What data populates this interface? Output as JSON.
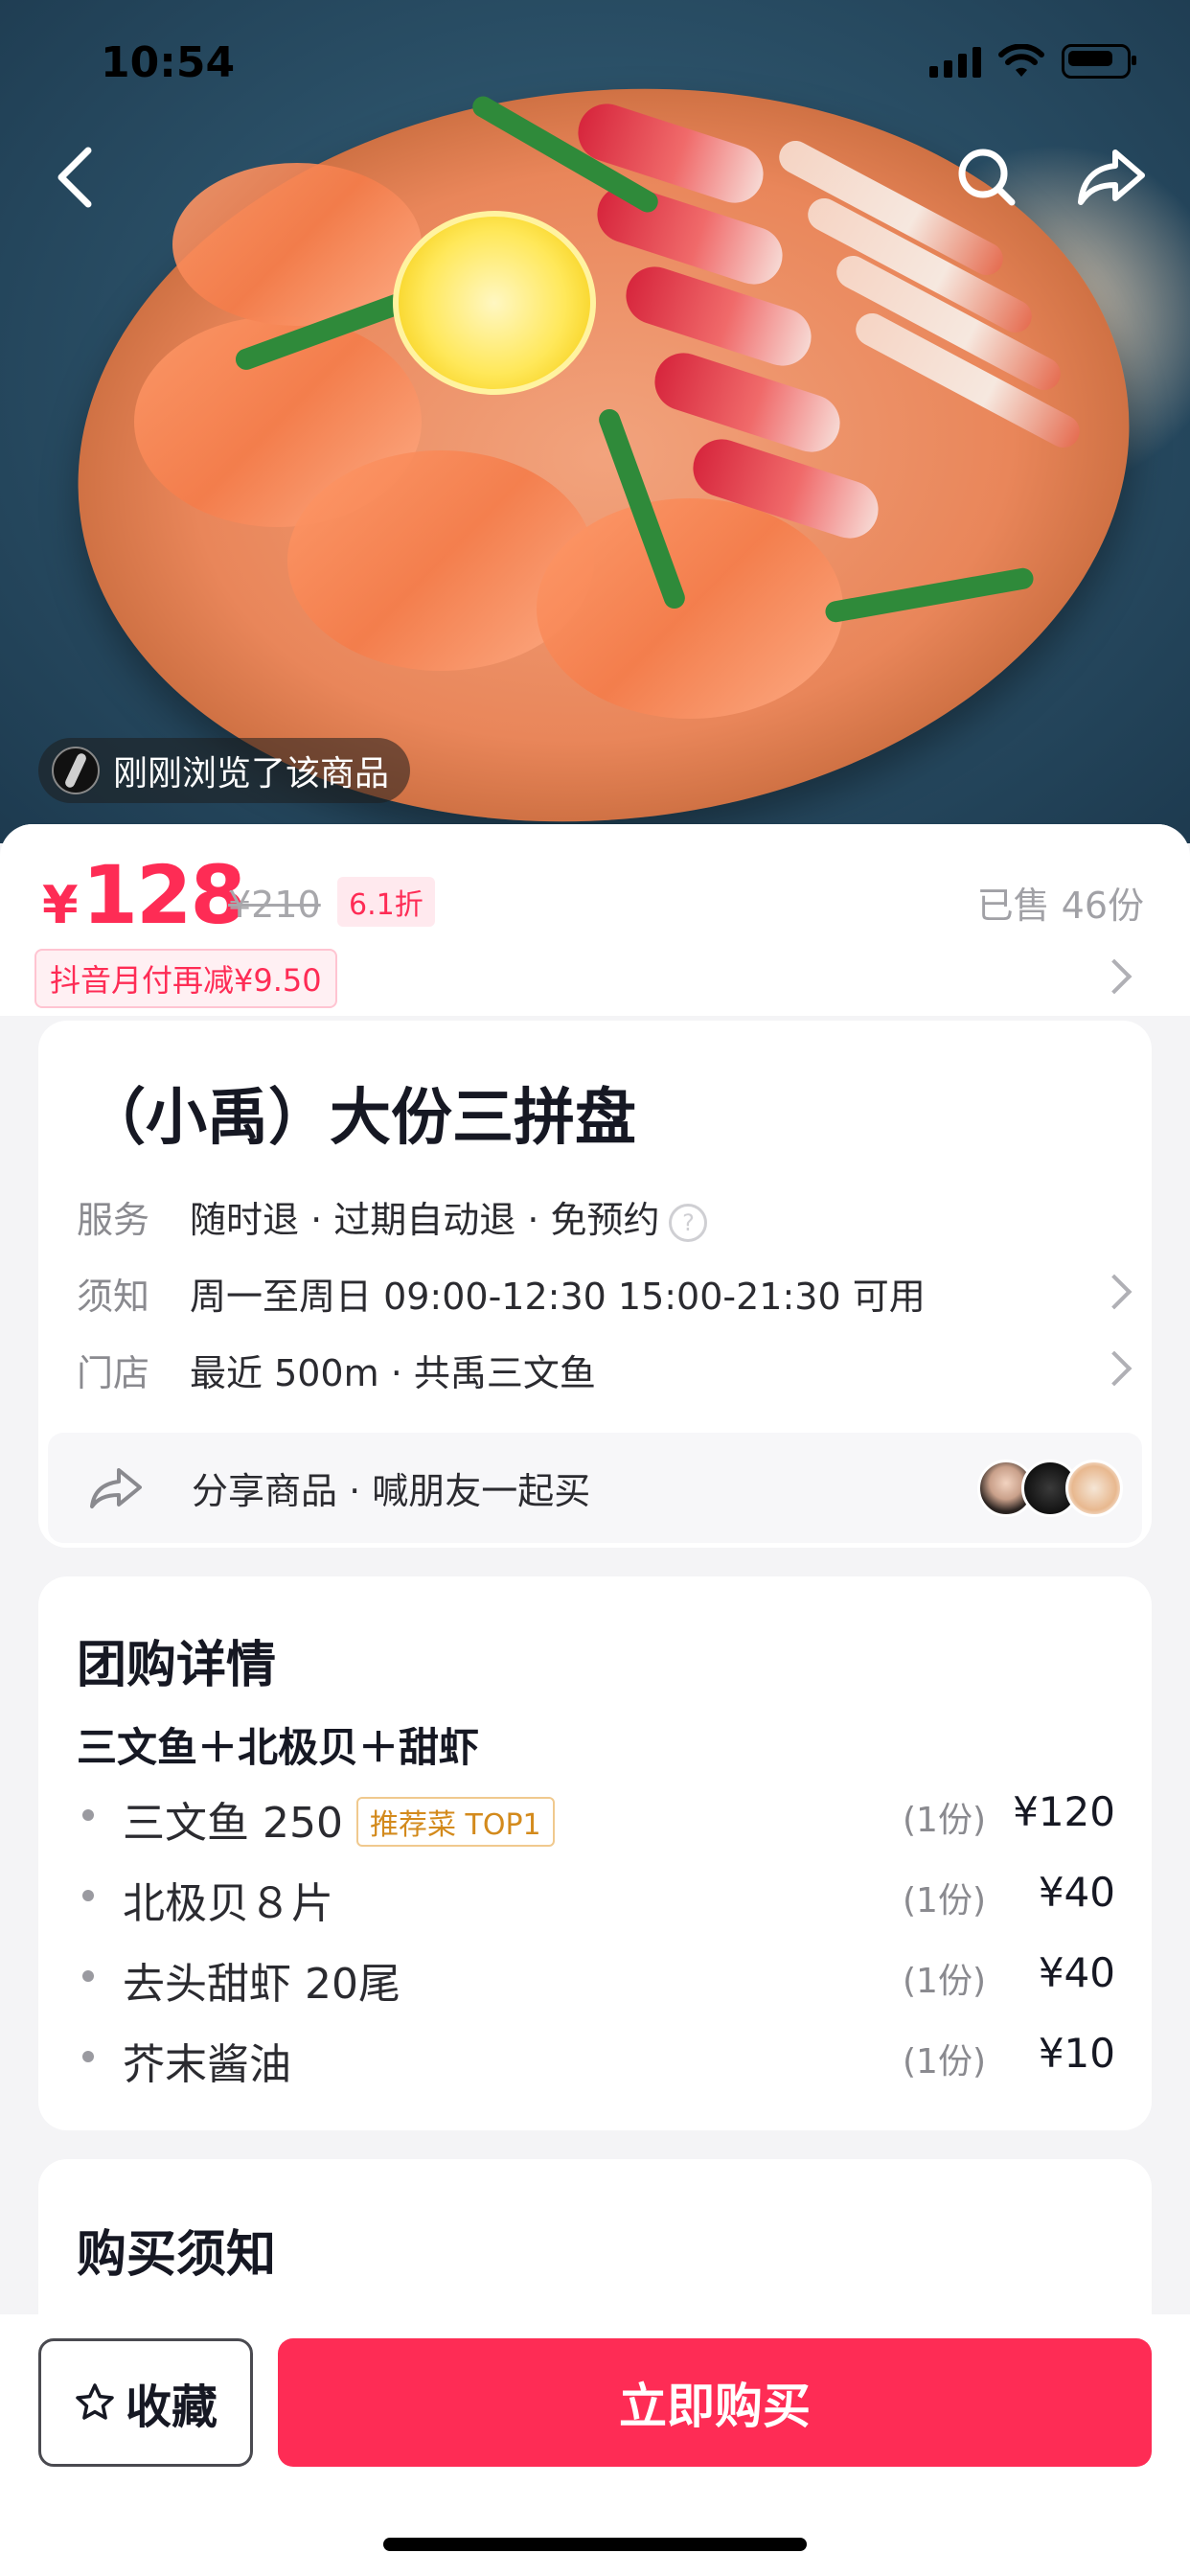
{
  "status_bar": {
    "time": "10:54"
  },
  "hero": {
    "viewed_text": "刚刚浏览了该商品"
  },
  "price": {
    "symbol": "¥",
    "current": "128",
    "original": "¥210",
    "discount": "6.1折",
    "sold": "已售 46份",
    "promo": "抖音月付再减¥9.50"
  },
  "product": {
    "title": "（小禹）大份三拼盘",
    "rows": [
      {
        "label": "服务",
        "value": "随时退 · 过期自动退 · 免预约",
        "help": "?"
      },
      {
        "label": "须知",
        "value": "周一至周日 09:00-12:30 15:00-21:30 可用"
      },
      {
        "label": "门店",
        "value": "最近 500m · 共禹三文鱼"
      }
    ],
    "share": "分享商品 · 喊朋友一起买"
  },
  "group_detail": {
    "title": "团购详情",
    "subtitle": "三文鱼＋北极贝＋甜虾",
    "items": [
      {
        "name": "三文鱼 250",
        "tag": "推荐菜 TOP1",
        "qty": "(1份)",
        "price": "¥120"
      },
      {
        "name": "北极贝８片",
        "qty": "(1份)",
        "price": "¥40"
      },
      {
        "name": "去头甜虾 20尾",
        "qty": "(1份)",
        "price": "¥40"
      },
      {
        "name": "芥末酱油",
        "qty": "(1份)",
        "price": "¥10"
      }
    ]
  },
  "notice": {
    "title": "购买须知"
  },
  "bottom": {
    "favorite": "收藏",
    "buy": "立即购买"
  },
  "colors": {
    "accent": "#fe2c55",
    "tag": "#d38a1c"
  }
}
